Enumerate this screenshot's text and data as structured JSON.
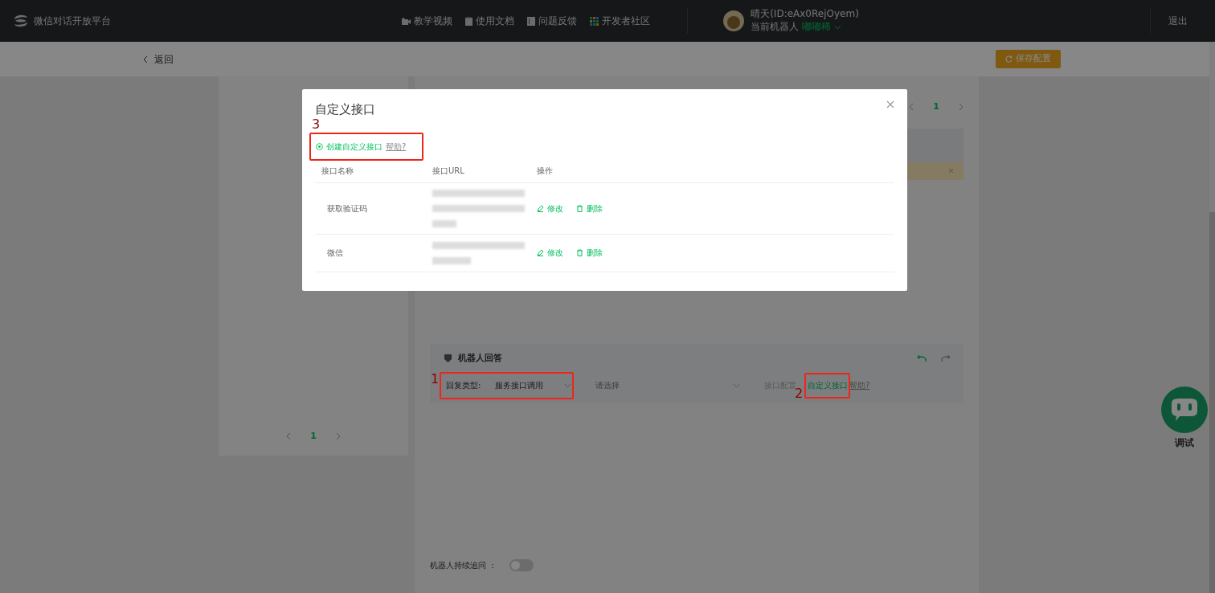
{
  "header": {
    "brand": "微信对话开放平台",
    "nav": [
      {
        "kind": "video",
        "label": "教学视频"
      },
      {
        "kind": "doc",
        "label": "使用文档"
      },
      {
        "kind": "feedback",
        "label": "问题反馈"
      },
      {
        "kind": "community",
        "label": "开发者社区"
      }
    ],
    "user": {
      "name": "晴天(ID:eAx0RejOyem)",
      "robot_label": "当前机器人",
      "robot_name": "嘟嘟稀"
    },
    "logout": "退出"
  },
  "toolbar": {
    "back": "返回",
    "save": "保存配置"
  },
  "left_panel": {
    "pages": [
      {
        "label": "1",
        "selected": true
      }
    ]
  },
  "editor": {
    "pages": [
      {
        "label": "1",
        "selected": true
      }
    ],
    "reply_card": {
      "title": "机器人回答",
      "reply_type_label": "回复类型:",
      "reply_type_value": "服务接口调用",
      "select_placeholder": "请选择",
      "config_label": "接口配置",
      "custom_link": "自定义接口",
      "help_link": "帮助?"
    },
    "follow_up": {
      "label": "机器人持续追问 ：",
      "on": false
    }
  },
  "debug_button": {
    "label": "调试"
  },
  "modal": {
    "title": "自定义接口",
    "create_link": "创建自定义接口",
    "help_link": "帮助?",
    "columns": [
      "接口名称",
      "接口URL",
      "操作"
    ],
    "rows": [
      {
        "name": "获取验证码",
        "actions": [
          "修改",
          "删除"
        ]
      },
      {
        "name": "微信",
        "actions": [
          "修改",
          "删除"
        ]
      }
    ]
  },
  "annotations": [
    {
      "label": "3"
    },
    {
      "label": "1"
    },
    {
      "label": "2"
    }
  ]
}
